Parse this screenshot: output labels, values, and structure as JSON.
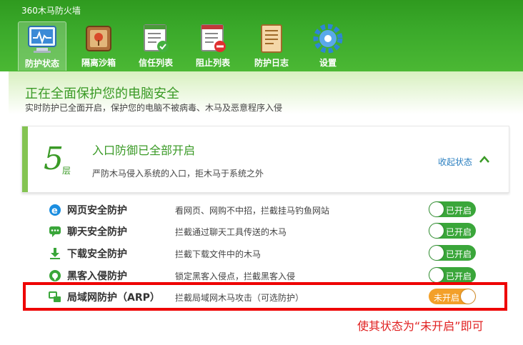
{
  "app": {
    "title": "360木马防火墙"
  },
  "tabs": [
    {
      "label": "防护状态",
      "icon": "monitor-heartbeat-icon",
      "active": true
    },
    {
      "label": "隔离沙箱",
      "icon": "sandbox-box-icon",
      "active": false
    },
    {
      "label": "信任列表",
      "icon": "trust-list-icon",
      "active": false
    },
    {
      "label": "阻止列表",
      "icon": "block-list-icon",
      "active": false
    },
    {
      "label": "防护日志",
      "icon": "log-notebook-icon",
      "active": false
    },
    {
      "label": "设置",
      "icon": "gear-icon",
      "active": false
    }
  ],
  "status": {
    "headline": "正在全面保护您的电脑安全",
    "subline": "实时防护已全面开启，保护您的电脑不被病毒、木马及恶意程序入侵"
  },
  "card": {
    "layer_number": "5",
    "layer_unit": "层",
    "title": "入口防御已全部开启",
    "description": "严防木马侵入系统的入口，拒木马于系统之外",
    "collapse_label": "收起状态"
  },
  "rows": [
    {
      "name": "网页安全防护",
      "desc": "看网页、网购不中招，拦截挂马钓鱼网站",
      "toggle": "已开启",
      "on": true,
      "icon": "ie-browser-icon"
    },
    {
      "name": "聊天安全防护",
      "desc": "拦截通过聊天工具传送的木马",
      "toggle": "已开启",
      "on": true,
      "icon": "chat-bubble-icon"
    },
    {
      "name": "下载安全防护",
      "desc": "拦截下载文件中的木马",
      "toggle": "已开启",
      "on": true,
      "icon": "download-arrow-icon"
    },
    {
      "name": "黑客入侵防护",
      "desc": "锁定黑客入侵点，拦截黑客入侵",
      "toggle": "已开启",
      "on": true,
      "icon": "hacker-shield-icon"
    },
    {
      "name": "局域网防护（ARP）",
      "desc": "拦截局域网木马攻击（可选防护）",
      "toggle": "未开启",
      "on": false,
      "icon": "lan-network-icon"
    }
  ],
  "annotation": "使其状态为“未开启”即可",
  "colors": {
    "brand_green": "#3aa92a",
    "toggle_on": "#3aa63a",
    "toggle_off": "#f3a02a",
    "highlight_red": "#ee0000"
  }
}
